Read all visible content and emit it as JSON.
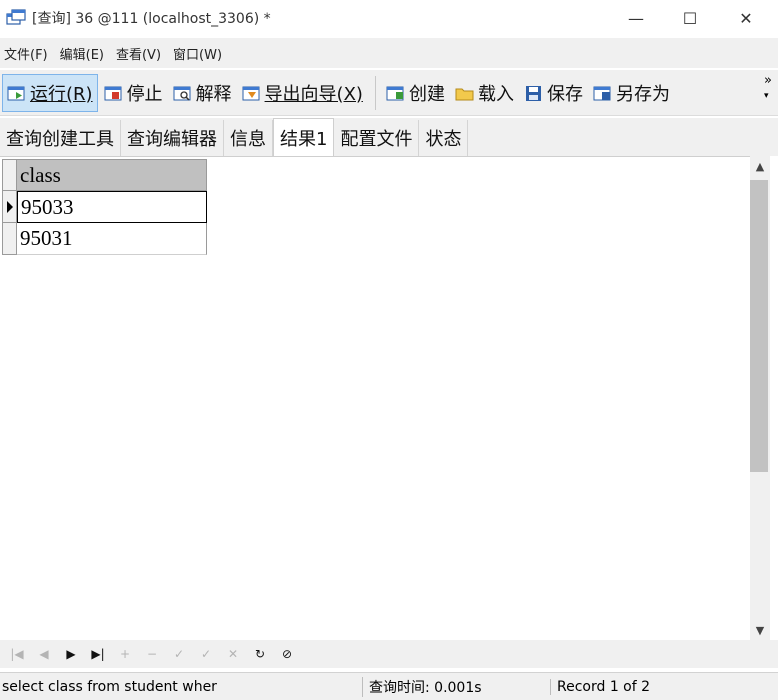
{
  "window": {
    "title": "[查询] 36 @111 (localhost_3306) *",
    "min_glyph": "—",
    "max_glyph": "☐",
    "close_glyph": "✕"
  },
  "menu": [
    "文件(F)",
    "编辑(E)",
    "查看(V)",
    "窗口(W)"
  ],
  "toolbar": {
    "run": "运行(R)",
    "stop": "停止",
    "explain": "解释",
    "export": "导出向导(X)",
    "create": "创建",
    "load": "载入",
    "save": "保存",
    "save_as": "另存为",
    "more": "»"
  },
  "tabs": [
    "查询创建工具",
    "查询编辑器",
    "信息",
    "结果1",
    "配置文件",
    "状态"
  ],
  "active_tab": "结果1",
  "result": {
    "columns": [
      "class"
    ],
    "rows": [
      [
        "95033"
      ],
      [
        "95031"
      ]
    ],
    "selected_row": 0
  },
  "navigator": {
    "first": "|◀",
    "prev": "◀",
    "next": "▶",
    "last": "▶|",
    "add": "+",
    "delete": "−",
    "edit": "✓",
    "post": "✓",
    "cancel": "✕",
    "refresh": "↻",
    "stop": "⊘"
  },
  "status": {
    "sql": "select class from student  wher",
    "query_time": "查询时间: 0.001s",
    "record": "Record 1 of 2"
  }
}
